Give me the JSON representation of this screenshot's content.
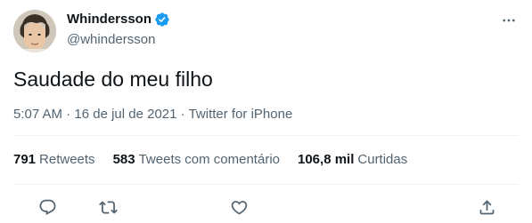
{
  "tweet": {
    "author": {
      "display_name": "Whindersson",
      "handle": "@whindersson",
      "verified": true
    },
    "text": "Saudade do meu filho",
    "meta": {
      "time": "5:07 AM",
      "separator": "·",
      "date": "16 de jul de 2021",
      "source": "Twitter for iPhone"
    },
    "stats": {
      "retweets_value": "791",
      "retweets_label": "Retweets",
      "quotes_value": "583",
      "quotes_label": "Tweets com comentário",
      "likes_value": "106,8 mil",
      "likes_label": "Curtidas"
    }
  },
  "icons": {
    "verified": "verified-badge-icon",
    "more": "more-icon",
    "reply": "reply-icon",
    "retweet": "retweet-icon",
    "like": "like-icon",
    "share": "share-icon"
  },
  "colors": {
    "text_primary": "#0f1419",
    "text_secondary": "#536471",
    "verified_blue": "#1d9bf0",
    "divider": "#eff3f4"
  }
}
